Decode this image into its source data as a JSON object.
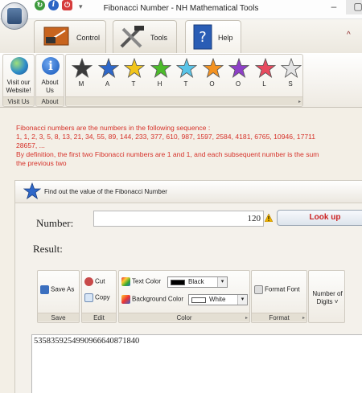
{
  "window": {
    "title": "Fibonacci Number - NH Mathematical Tools",
    "minimize": "–",
    "maximize": "▢"
  },
  "qat": {
    "info": "i",
    "dropdown": "▾"
  },
  "tabs": [
    {
      "label": "Control",
      "icon": "control-panel-icon"
    },
    {
      "label": "Tools",
      "icon": "tools-icon"
    },
    {
      "label": "Help",
      "icon": "help-book-icon",
      "active": true
    }
  ],
  "ribbon": {
    "collapse": "^",
    "visit_us": {
      "button": "Visit our\nWebsite!",
      "group": "Visit Us"
    },
    "about": {
      "button": "About\nUs",
      "group": "About"
    },
    "math_stars": [
      {
        "letter": "M",
        "color": "#3a3a3a"
      },
      {
        "letter": "A",
        "color": "#2e67c9"
      },
      {
        "letter": "T",
        "color": "#f2c51a"
      },
      {
        "letter": "H",
        "color": "#4cbb2a"
      },
      {
        "letter": "T",
        "color": "#59c4e8"
      },
      {
        "letter": "O",
        "color": "#f39221"
      },
      {
        "letter": "O",
        "color": "#8e3fc7"
      },
      {
        "letter": "L",
        "color": "#e84a5e"
      },
      {
        "letter": "S",
        "color": "#e4e4e4"
      }
    ]
  },
  "intro_text": "Fibonacci numbers are the numbers in the following sequence :\n1, 1, 2, 3, 5, 8, 13, 21, 34, 55, 89, 144, 233, 377, 610, 987, 1597, 2584, 4181, 6765, 10946, 17711\n28657, ...\nBy definition, the first two Fibonacci numbers are 1 and 1, and each subsequent number is the sum\nthe previous two",
  "panel": {
    "title": "Find out the value of the Fibonacci Number",
    "number_label": "Number:",
    "number_value": "120",
    "lookup_button": "Look up",
    "result_label": "Result:",
    "result_value": "5358359254990966640871840"
  },
  "result_toolbar": {
    "save_as": "Save As",
    "save_group": "Save",
    "cut": "Cut",
    "copy": "Copy",
    "edit_group": "Edit",
    "text_color_label": "Text Color",
    "text_color_value": "Black",
    "text_color_hex": "#000000",
    "background_color_label": "Background Color",
    "background_color_value": "White",
    "background_color_hex": "#ffffff",
    "color_group": "Color",
    "format_font": "Format Font",
    "format_group": "Format",
    "number_of_digits": "Number of\nDigits ˅"
  },
  "colors": {
    "intro_text": "#d6322a",
    "lookup_text": "#cc2222"
  }
}
